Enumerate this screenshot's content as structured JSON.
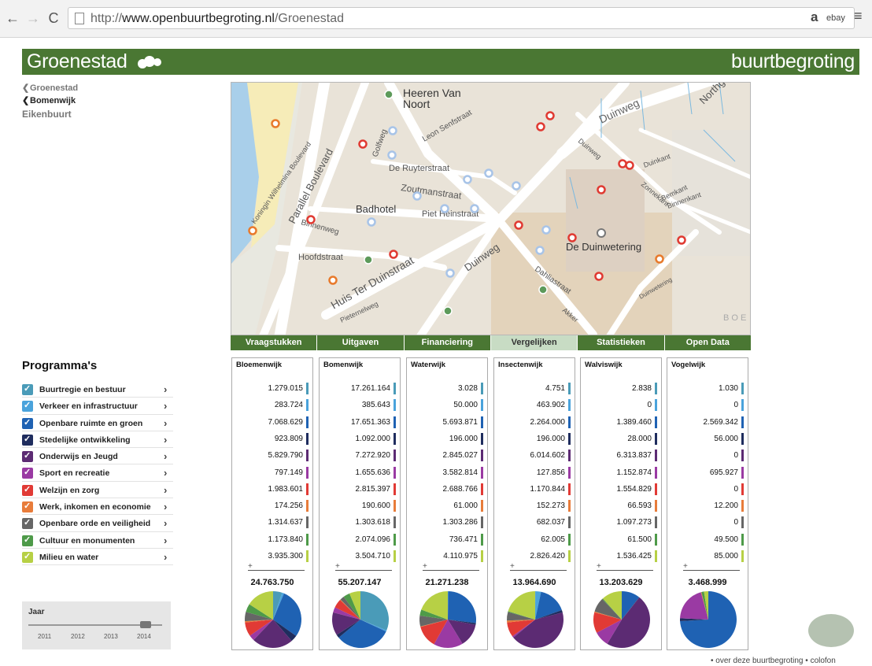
{
  "browser": {
    "url_prefix": "http://",
    "url_domain": "www.openbuurtbegroting.nl",
    "url_path": "/Groenestad",
    "back_icon": "←",
    "forward_icon": "→",
    "reload_icon": "C",
    "ext_amazon": "a",
    "ext_ebay": "ebay",
    "menu_icon": "≡"
  },
  "header": {
    "title": "Groenestad",
    "right_title": "buurtbegroting",
    "color": "#4a7733"
  },
  "breadcrumb": {
    "chevron": "❮",
    "items": [
      "Groenestad",
      "Bomenwijk",
      "Eikenbuurt"
    ]
  },
  "map": {
    "labels": {
      "heeren": "Heeren Van",
      "noort": "Noort",
      "duinweg_top": "Duinweg",
      "parallel": "Parallel Boulevard",
      "koningin": "Koningin Wilhelmina Boulevard",
      "golfweg": "Golfweg",
      "ruyter": "De Ruyterstraat",
      "senf": "Leon Senfstraat",
      "zoutman": "Zoutmanstraat",
      "heinstraat": "Piet Heinstraat",
      "badhotel": "Badhotel",
      "binnenweg": "Binnenweg",
      "hoofdstraat": "Hoofdstraat",
      "terduin": "Huis Ter Duinstraat",
      "duinweg_mid": "Duinweg",
      "duinwetering": "De Duinwetering",
      "dahlia": "Dahliastraat",
      "pieternel": "Pieternelweg",
      "duinkant": "Duinkant",
      "zonnekant": "Zonnekant",
      "bemkant": "Bemkant",
      "binnenkant": "Binnenkant",
      "northgo": "Northgo",
      "boe": "B O E",
      "duinweg_small": "Duinweg",
      "akker": "Akker",
      "duinwetering_r": "Duinwetering"
    },
    "marker_colors": {
      "red": "#e03a32",
      "orange": "#e87a2c",
      "blue": "#a8c4e8",
      "green": "#5d9a5a"
    }
  },
  "tabs": [
    "Vraagstukken",
    "Uitgaven",
    "Financiering",
    "Vergelijken",
    "Statistieken",
    "Open Data"
  ],
  "active_tab": "Vergelijken",
  "programs": {
    "title": "Programma's",
    "arrow": "›",
    "items": [
      {
        "label": "Buurtregie en bestuur",
        "color": "#4a9bb8"
      },
      {
        "label": "Verkeer en infrastructuur",
        "color": "#4aa3dc"
      },
      {
        "label": "Openbare ruimte en groen",
        "color": "#1f62b3"
      },
      {
        "label": "Stedelijke ontwikkeling",
        "color": "#1f2d5e"
      },
      {
        "label": "Onderwijs en Jeugd",
        "color": "#5c2b73"
      },
      {
        "label": "Sport en recreatie",
        "color": "#9a3aa3"
      },
      {
        "label": "Welzijn en zorg",
        "color": "#e13a35"
      },
      {
        "label": "Werk, inkomen en economie",
        "color": "#e87c3a"
      },
      {
        "label": "Openbare orde en veiligheid",
        "color": "#666666"
      },
      {
        "label": "Cultuur en monumenten",
        "color": "#4e9a49"
      },
      {
        "label": "Milieu en water",
        "color": "#b7d045"
      }
    ]
  },
  "year": {
    "label": "Jaar",
    "ticks": [
      "2011",
      "2012",
      "2013",
      "2014"
    ],
    "selected": "2014"
  },
  "comparison": {
    "plus": "+",
    "columns": [
      {
        "name": "Bloemenwijk",
        "values": [
          "1.279.015",
          "283.724",
          "7.068.629",
          "923.809",
          "5.829.790",
          "797.149",
          "1.983.601",
          "174.256",
          "1.314.637",
          "1.173.840",
          "3.935.300"
        ],
        "total": "24.763.750",
        "numbers": [
          1279015,
          283724,
          7068629,
          923809,
          5829790,
          797149,
          1983601,
          174256,
          1314637,
          1173840,
          3935300
        ]
      },
      {
        "name": "Bomenwijk",
        "values": [
          "17.261.164",
          "385.643",
          "17.651.363",
          "1.092.000",
          "7.272.920",
          "1.655.636",
          "2.815.397",
          "190.600",
          "1.303.618",
          "2.074.096",
          "3.504.710"
        ],
        "total": "55.207.147",
        "numbers": [
          17261164,
          385643,
          17651363,
          1092000,
          7272920,
          1655636,
          2815397,
          190600,
          1303618,
          2074096,
          3504710
        ]
      },
      {
        "name": "Waterwijk",
        "values": [
          "3.028",
          "50.000",
          "5.693.871",
          "196.000",
          "2.845.027",
          "3.582.814",
          "2.688.766",
          "61.000",
          "1.303.286",
          "736.471",
          "4.110.975"
        ],
        "total": "21.271.238",
        "numbers": [
          3028,
          50000,
          5693871,
          196000,
          2845027,
          3582814,
          2688766,
          61000,
          1303286,
          736471,
          4110975
        ]
      },
      {
        "name": "Insectenwijk",
        "values": [
          "4.751",
          "463.902",
          "2.264.000",
          "196.000",
          "6.014.602",
          "127.856",
          "1.170.844",
          "152.273",
          "682.037",
          "62.005",
          "2.826.420"
        ],
        "total": "13.964.690",
        "numbers": [
          4751,
          463902,
          2264000,
          196000,
          6014602,
          127856,
          1170844,
          152273,
          682037,
          62005,
          2826420
        ]
      },
      {
        "name": "Walviswijk",
        "values": [
          "2.838",
          "0",
          "1.389.460",
          "28.000",
          "6.313.837",
          "1.152.874",
          "1.554.829",
          "66.593",
          "1.097.273",
          "61.500",
          "1.536.425"
        ],
        "total": "13.203.629",
        "numbers": [
          2838,
          0,
          1389460,
          28000,
          6313837,
          1152874,
          1554829,
          66593,
          1097273,
          61500,
          1536425
        ]
      },
      {
        "name": "Vogelwijk",
        "values": [
          "1.030",
          "0",
          "2.569.342",
          "56.000",
          "0",
          "695.927",
          "0",
          "12.200",
          "0",
          "49.500",
          "85.000"
        ],
        "total": "3.468.999",
        "numbers": [
          1030,
          0,
          2569342,
          56000,
          0,
          695927,
          0,
          12200,
          0,
          49500,
          85000
        ]
      }
    ]
  },
  "footer": {
    "bullet": "•",
    "about": "over deze buurtbegroting",
    "colofon": "colofon"
  }
}
